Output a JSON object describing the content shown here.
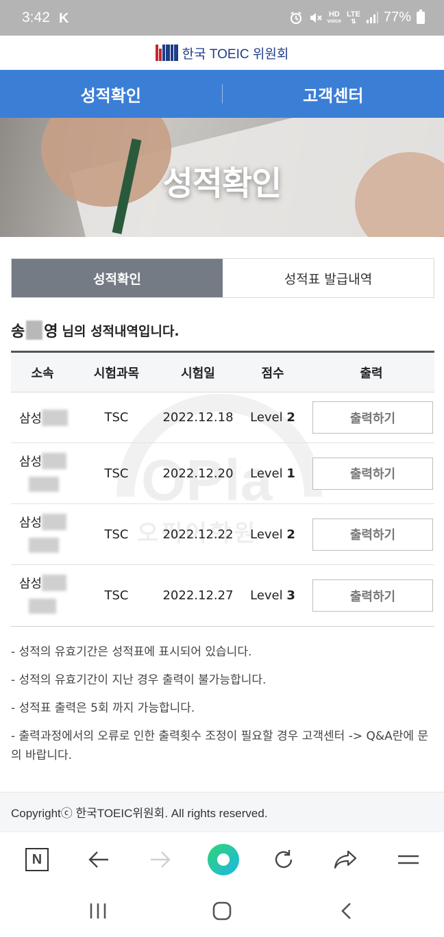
{
  "status_bar": {
    "time": "3:42",
    "app_icon": "K",
    "network_top": "HD",
    "network_bottom": "voice",
    "lte": "LTE",
    "battery": "77%"
  },
  "header": {
    "logo_text": "한국 TOEIC 위원회"
  },
  "nav": {
    "items": [
      "성적확인",
      "고객센터"
    ]
  },
  "hero": {
    "title": "성적확인"
  },
  "tabs": [
    {
      "label": "성적확인",
      "active": true
    },
    {
      "label": "성적표 발급내역",
      "active": false
    }
  ],
  "result": {
    "name_first": "송",
    "name_last": "영",
    "suffix": "님의 성적내역입니다."
  },
  "table": {
    "headers": [
      "소속",
      "시험과목",
      "시험일",
      "점수",
      "출력"
    ],
    "rows": [
      {
        "affiliation": "삼성",
        "subject": "TSC",
        "date": "2022.12.18",
        "level_label": "Level",
        "level": "2",
        "action": "출력하기"
      },
      {
        "affiliation": "삼성",
        "subject": "TSC",
        "date": "2022.12.20",
        "level_label": "Level",
        "level": "1",
        "action": "출력하기"
      },
      {
        "affiliation": "삼성",
        "subject": "TSC",
        "date": "2022.12.22",
        "level_label": "Level",
        "level": "2",
        "action": "출력하기"
      },
      {
        "affiliation": "삼성",
        "subject": "TSC",
        "date": "2022.12.27",
        "level_label": "Level",
        "level": "3",
        "action": "출력하기"
      }
    ]
  },
  "watermark": {
    "text": "OPla",
    "sub": "오픽어학원"
  },
  "notes": [
    "- 성적의 유효기간은 성적표에 표시되어 있습니다.",
    "- 성적의 유효기간이 지난 경우 출력이 불가능합니다.",
    "- 성적표 출력은 5회 까지 가능합니다.",
    "- 출력과정에서의 오류로 인한 출력횟수 조정이 필요할 경우 고객센터 -> Q&A란에 문의 바랍니다."
  ],
  "footer": {
    "copyright": "Copyrightⓒ 한국TOEIC위원회. All rights reserved."
  },
  "browser_toolbar": {
    "n_label": "N",
    "icons": [
      "n-icon",
      "back-arrow-icon",
      "forward-arrow-icon",
      "home-orb-icon",
      "refresh-icon",
      "share-icon",
      "menu-icon"
    ]
  },
  "android_nav": {
    "icons": [
      "recent-apps-icon",
      "home-icon",
      "back-icon"
    ]
  },
  "colors": {
    "nav_blue": "#3b7ed6",
    "active_tab": "#757b85",
    "status_bar": "#b4b4b4"
  }
}
